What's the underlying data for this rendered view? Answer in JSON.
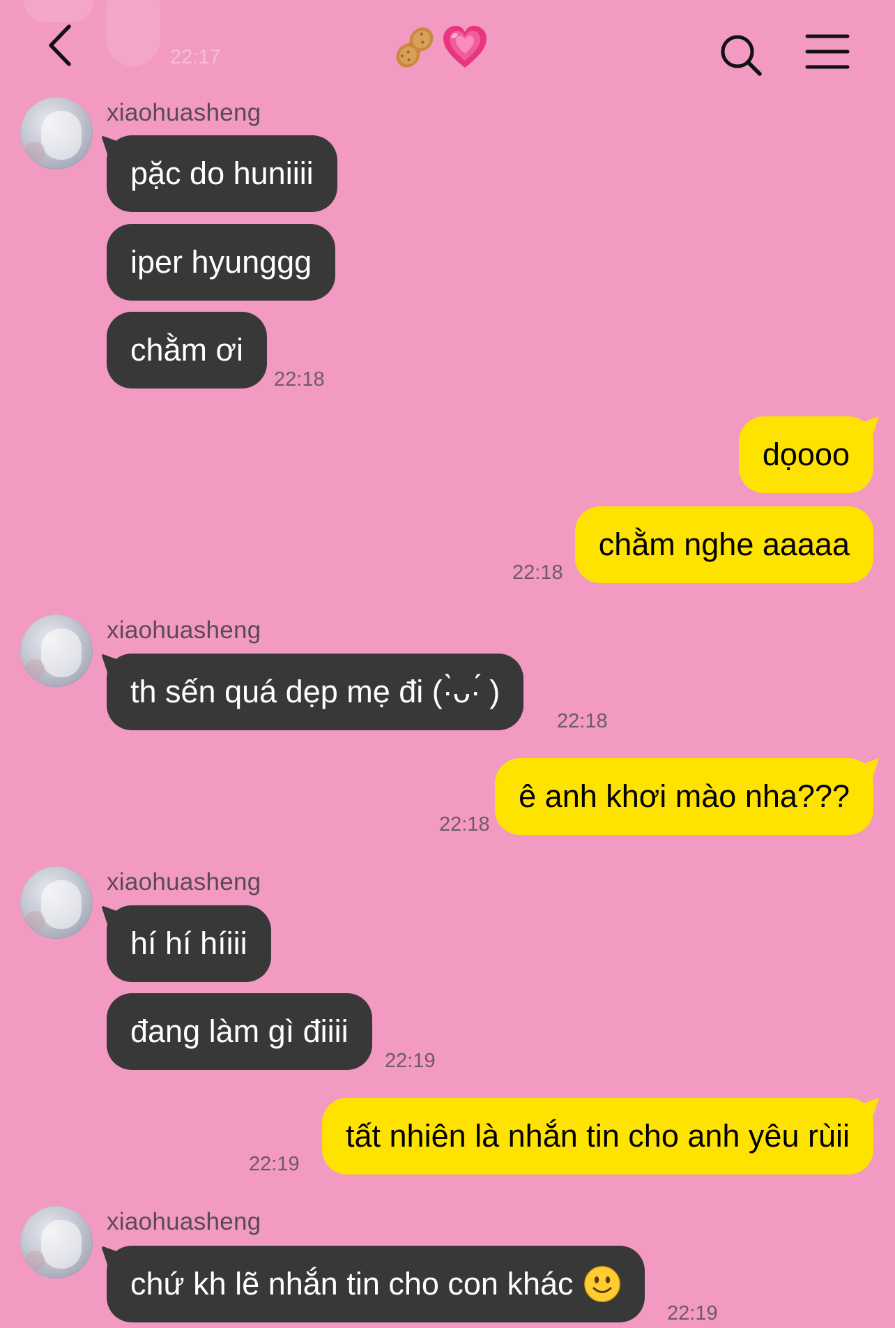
{
  "header": {
    "ghost_time": "22:17",
    "title_icons": [
      "peanut-icon",
      "growing-heart-icon"
    ],
    "back_icon": "chevron-left-icon",
    "search_icon": "search-icon",
    "menu_icon": "hamburger-menu-icon"
  },
  "colors": {
    "background": "#f39ac2",
    "incoming_bubble": "#383838",
    "outgoing_bubble": "#ffe300"
  },
  "messages": [
    {
      "sender": "xiaohuasheng",
      "text": "pặc do huniiii"
    },
    {
      "text": "iper hyunggg"
    },
    {
      "text": "chằm ơi",
      "time": "22:18"
    },
    {
      "text": "dọooo"
    },
    {
      "text": "chằm nghe aaaaa",
      "time": "22:18"
    },
    {
      "sender": "xiaohuasheng",
      "text": "th sến quá dẹp mẹ đi (·̀ᴗ·́ )",
      "time": "22:18"
    },
    {
      "text": "ê anh khơi mào nha???",
      "time": "22:18"
    },
    {
      "sender": "xiaohuasheng",
      "text": "hí hí híiii"
    },
    {
      "text": "đang làm gì điiii",
      "time": "22:19"
    },
    {
      "text": "tất nhiên là nhắn tin cho anh yêu rùii",
      "time": "22:19"
    },
    {
      "sender": "xiaohuasheng",
      "text": "chứ kh lẽ nhắn tin cho con khác",
      "emoji": "slightly-smiling-face",
      "time": "22:19"
    }
  ]
}
